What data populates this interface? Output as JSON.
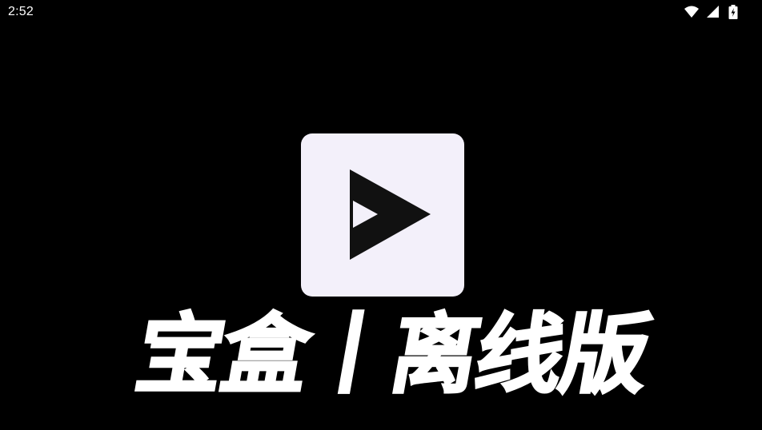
{
  "status_bar": {
    "time": "2:52",
    "icons": [
      "wifi-icon",
      "cellular-signal-icon",
      "battery-charging-icon"
    ]
  },
  "splash": {
    "app_icon": "play-logo-icon",
    "title": "宝盒丨离线版"
  },
  "colors": {
    "background": "#000000",
    "icon_tile": "#f3f0fa",
    "logo": "#111111",
    "text": "#ffffff"
  }
}
